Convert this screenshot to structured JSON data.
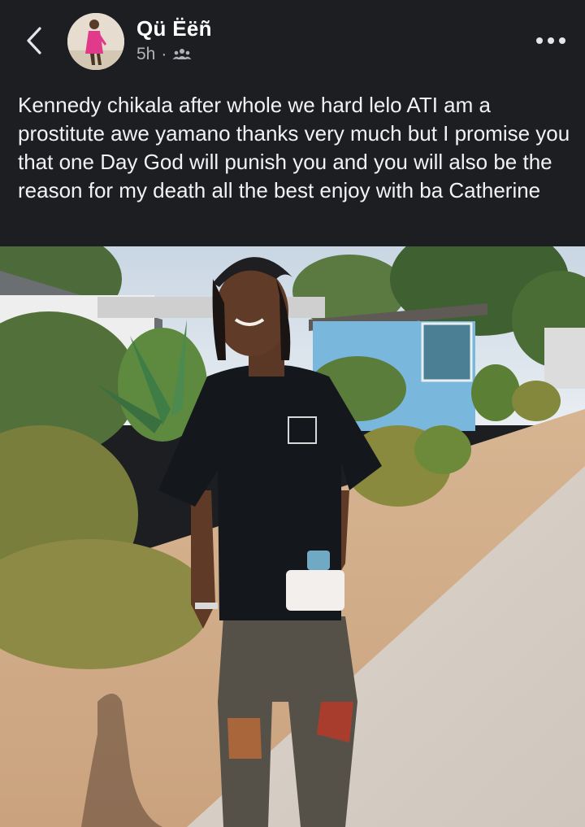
{
  "header": {
    "author_name": "Qü Ëëñ",
    "timestamp": "5h",
    "separator": "·",
    "audience_icon": "friends-icon",
    "back_icon": "back-chevron-icon",
    "more_icon": "more-options-icon"
  },
  "post": {
    "text": "Kennedy chikala after whole we hard lelo ATI am a prostitute awe yamano thanks very much but I promise you that one Day God will punish you and you will also be the reason for my death all the best enjoy with ba Catherine"
  },
  "colors": {
    "background": "#1c1e21",
    "text_primary": "#f0f2f5",
    "text_secondary": "#b0b3b8"
  }
}
